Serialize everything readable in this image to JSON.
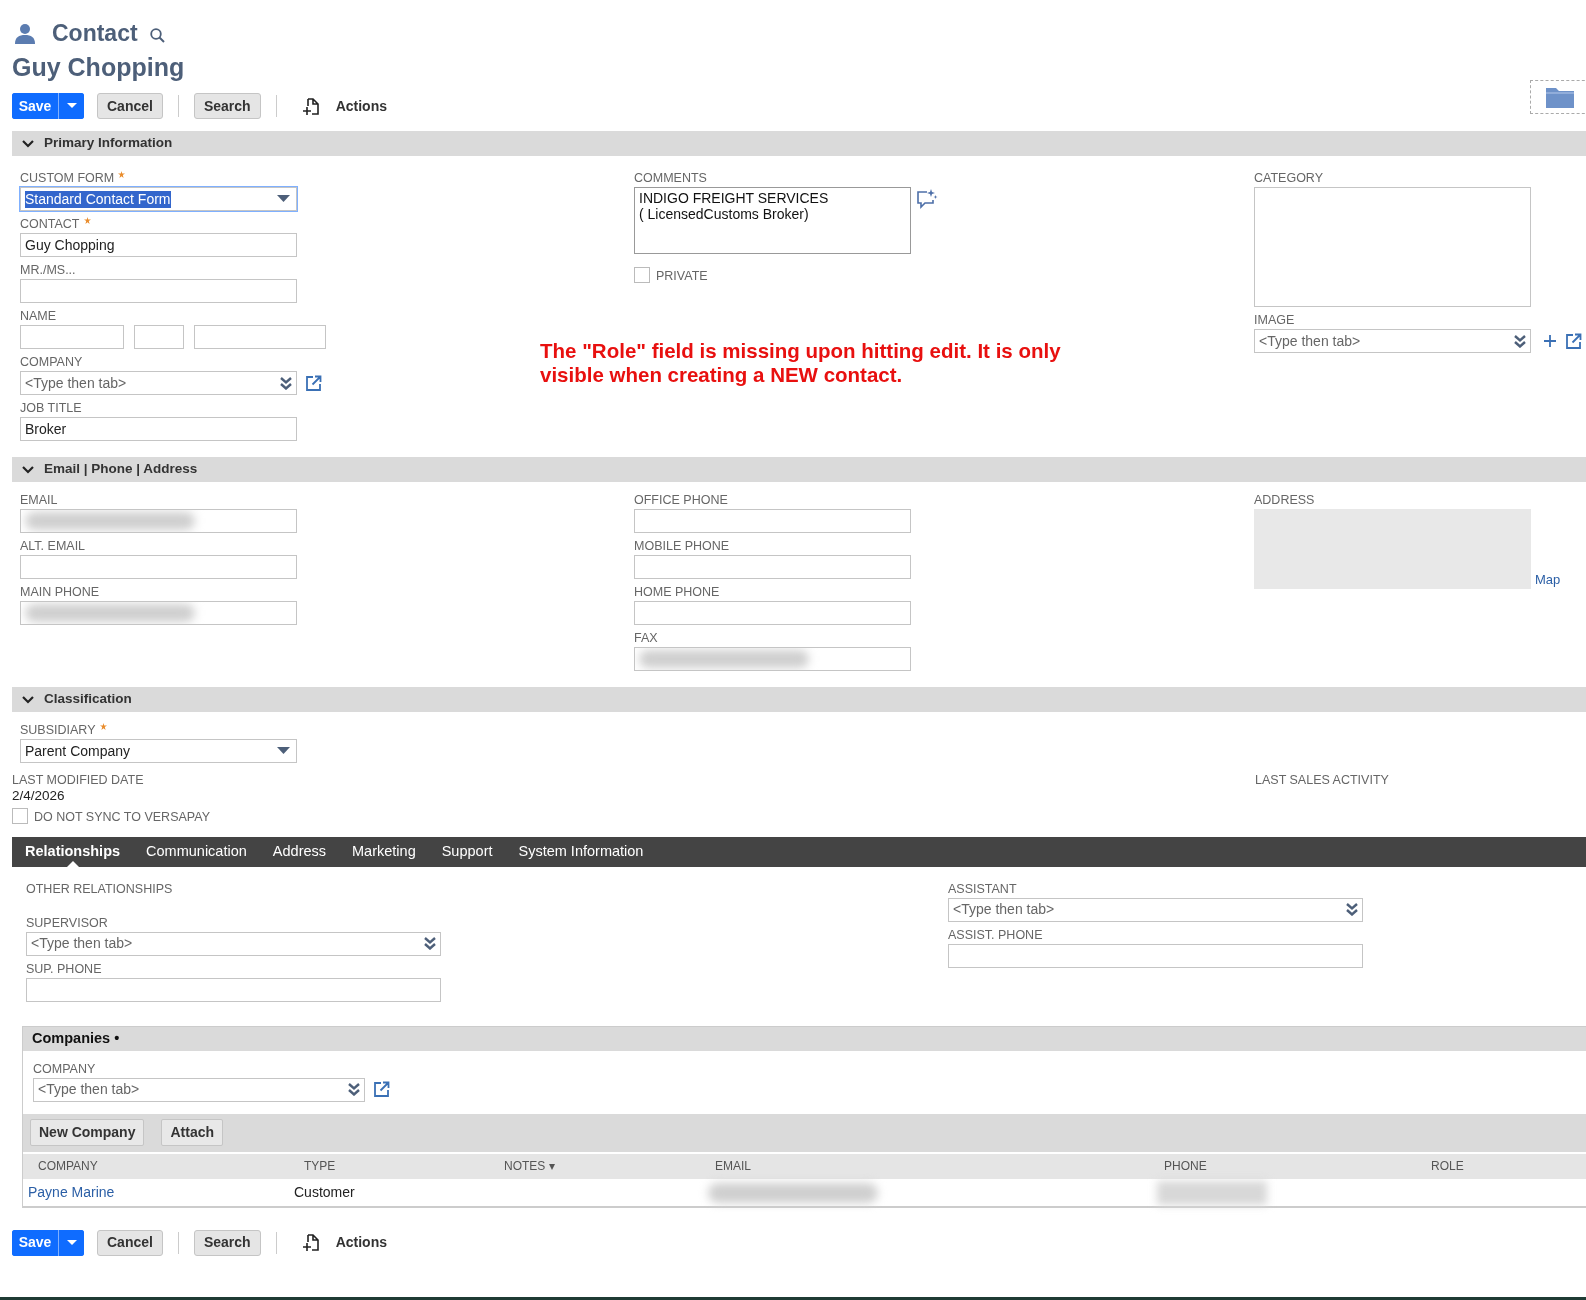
{
  "header": {
    "record_type": "Contact",
    "title": "Guy Chopping"
  },
  "toolbar_top": {
    "save": "Save",
    "cancel": "Cancel",
    "search": "Search",
    "actions": "Actions"
  },
  "primary": {
    "title": "Primary Information",
    "expanded": true,
    "columns": [
      [
        {
          "kind": "select",
          "label": "CUSTOM FORM",
          "required": true,
          "value": "Standard Contact Form",
          "focused": true
        },
        {
          "kind": "text",
          "label": "CONTACT",
          "required": true,
          "value": "Guy Chopping"
        },
        {
          "kind": "text",
          "label": "MR./MS..."
        },
        {
          "kind": "name",
          "label": "NAME"
        },
        {
          "kind": "lookup",
          "label": "COMPANY",
          "placeholder": "<Type then tab>",
          "link_icon": true
        },
        {
          "kind": "text",
          "label": "JOB TITLE",
          "value": "Broker"
        }
      ],
      [
        {
          "kind": "textarea",
          "label": "COMMENTS",
          "value": "INDIGO FREIGHT SERVICES\n( LicensedCustoms Broker)"
        },
        {
          "kind": "checkbox",
          "label": "PRIVATE",
          "checked": false
        }
      ],
      [
        {
          "kind": "listbox",
          "label": "CATEGORY"
        },
        {
          "kind": "lookup",
          "label": "IMAGE",
          "placeholder": "<Type then tab>",
          "add_icon": true,
          "link_icon": true
        }
      ]
    ],
    "note": "The \"Role\" field is missing upon hitting edit. It is only visible when creating a NEW contact."
  },
  "contact_info": {
    "title": "Email | Phone | Address",
    "expanded": true,
    "columns": [
      [
        {
          "kind": "text",
          "label": "EMAIL",
          "blurred": true
        },
        {
          "kind": "text",
          "label": "ALT. EMAIL"
        },
        {
          "kind": "text",
          "label": "MAIN PHONE",
          "blurred": true
        }
      ],
      [
        {
          "kind": "text",
          "label": "OFFICE PHONE"
        },
        {
          "kind": "text",
          "label": "MOBILE PHONE"
        },
        {
          "kind": "text",
          "label": "HOME PHONE"
        },
        {
          "kind": "text",
          "label": "FAX",
          "blurred": true
        }
      ],
      [
        {
          "kind": "address",
          "label": "ADDRESS",
          "link": "Map"
        }
      ]
    ]
  },
  "classification": {
    "title": "Classification",
    "expanded": true,
    "subsidiary": {
      "kind": "select",
      "label": "SUBSIDIARY",
      "required": true,
      "value": "Parent Company",
      "focused": false
    },
    "last_modified": {
      "label": "LAST MODIFIED DATE",
      "value": "2/4/2026"
    },
    "last_sales_activity": {
      "label": "LAST SALES ACTIVITY"
    },
    "sync": {
      "label": "DO NOT SYNC TO VERSAPAY",
      "checked": false
    }
  },
  "tabs": [
    {
      "label": "Relationships",
      "selected": true
    },
    {
      "label": "Communication",
      "selected": false
    },
    {
      "label": "Address",
      "selected": false
    },
    {
      "label": "Marketing",
      "selected": false
    },
    {
      "label": "Support",
      "selected": false
    },
    {
      "label": "System Information",
      "selected": false
    }
  ],
  "relationships": {
    "heading": "OTHER RELATIONSHIPS",
    "left": [
      {
        "kind": "lookup",
        "label": "SUPERVISOR",
        "placeholder": "<Type then tab>"
      },
      {
        "kind": "text",
        "label": "SUP. PHONE"
      }
    ],
    "right": [
      {
        "kind": "lookup",
        "label": "ASSISTANT",
        "placeholder": "<Type then tab>"
      },
      {
        "kind": "text",
        "label": "ASSIST. PHONE"
      }
    ]
  },
  "companies": {
    "title": "Companies •",
    "field": {
      "kind": "lookup",
      "label": "COMPANY",
      "placeholder": "<Type then tab>",
      "link_icon": true
    },
    "buttons": [
      "New Company",
      "Attach"
    ],
    "columns": [
      "COMPANY",
      "TYPE",
      "NOTES ▾",
      "EMAIL",
      "PHONE",
      "ROLE"
    ],
    "rows": [
      {
        "company": "Payne Marine",
        "type": "Customer",
        "email_blurred": true,
        "phone_blurred": true
      }
    ]
  },
  "toolbar_bottom": {
    "save": "Save",
    "cancel": "Cancel",
    "search": "Search",
    "actions": "Actions"
  }
}
